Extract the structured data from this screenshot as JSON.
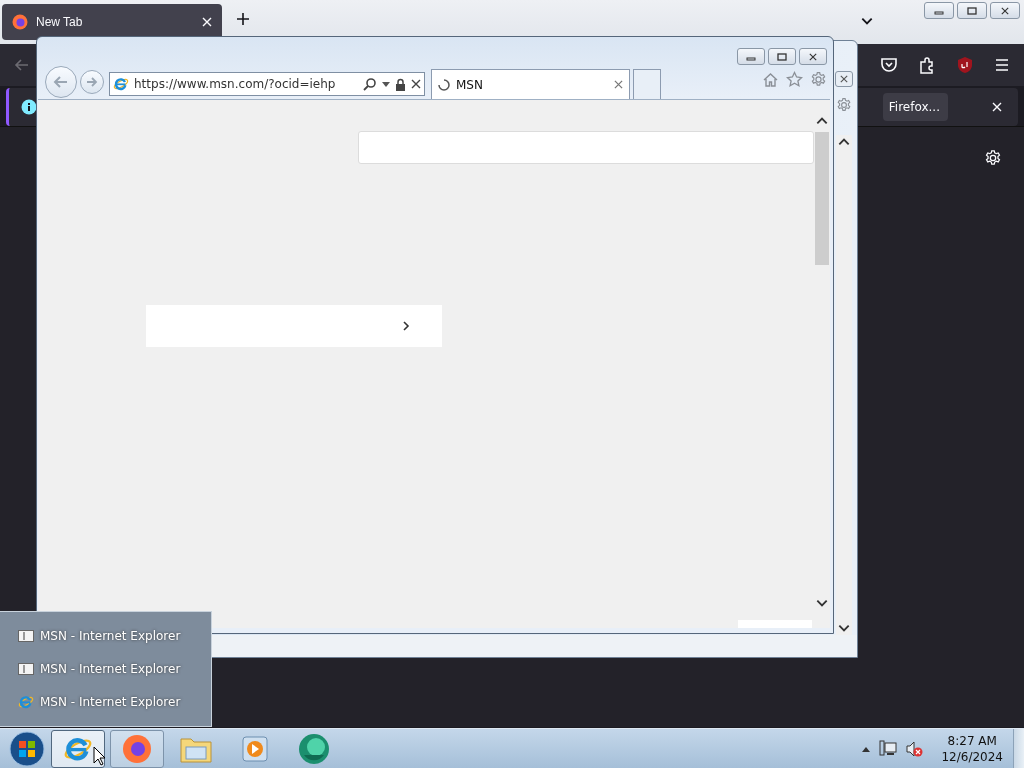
{
  "firefox": {
    "tabs": [
      {
        "label": "New Tab",
        "selected": true
      }
    ],
    "notification": {
      "button": "Firefox..."
    }
  },
  "ie": {
    "address": "https://www.msn.com/?ocid=iehp",
    "tabs": [
      {
        "label": "MSN",
        "selected": true,
        "loading": true
      }
    ]
  },
  "jump_list": {
    "items": [
      {
        "label": "MSN - Internet Explorer",
        "kind": "page"
      },
      {
        "label": "MSN - Internet Explorer",
        "kind": "page"
      },
      {
        "label": "MSN - Internet Explorer",
        "kind": "ie"
      }
    ]
  },
  "taskbar": {
    "buttons": [
      {
        "kind": "ie",
        "running": true,
        "selected": true
      },
      {
        "kind": "firefox",
        "running": true,
        "selected": false
      },
      {
        "kind": "explorer",
        "running": false,
        "selected": false
      },
      {
        "kind": "media",
        "running": false,
        "selected": false
      },
      {
        "kind": "app",
        "running": false,
        "selected": false
      }
    ],
    "clock": {
      "time": "8:27 AM",
      "date": "12/6/2024"
    }
  }
}
